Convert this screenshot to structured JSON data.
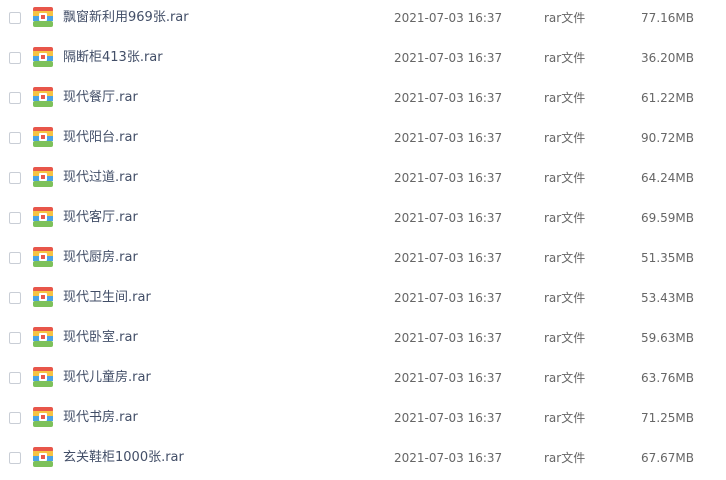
{
  "file_list": {
    "icon": "rar-archive-icon",
    "icon_colors": {
      "red": "#e8564a",
      "yellow": "#f6c344",
      "blue": "#4aa3e8",
      "green": "#7dc15a",
      "tag": "#ffffff"
    },
    "rows": [
      {
        "name": "飘窗新利用969张.rar",
        "time": "2021-07-03 16:37",
        "type": "rar文件",
        "size": "77.16MB"
      },
      {
        "name": "隔断柜413张.rar",
        "time": "2021-07-03 16:37",
        "type": "rar文件",
        "size": "36.20MB"
      },
      {
        "name": "现代餐厅.rar",
        "time": "2021-07-03 16:37",
        "type": "rar文件",
        "size": "61.22MB"
      },
      {
        "name": "现代阳台.rar",
        "time": "2021-07-03 16:37",
        "type": "rar文件",
        "size": "90.72MB"
      },
      {
        "name": "现代过道.rar",
        "time": "2021-07-03 16:37",
        "type": "rar文件",
        "size": "64.24MB"
      },
      {
        "name": "现代客厅.rar",
        "time": "2021-07-03 16:37",
        "type": "rar文件",
        "size": "69.59MB"
      },
      {
        "name": "现代厨房.rar",
        "time": "2021-07-03 16:37",
        "type": "rar文件",
        "size": "51.35MB"
      },
      {
        "name": "现代卫生间.rar",
        "time": "2021-07-03 16:37",
        "type": "rar文件",
        "size": "53.43MB"
      },
      {
        "name": "现代卧室.rar",
        "time": "2021-07-03 16:37",
        "type": "rar文件",
        "size": "59.63MB"
      },
      {
        "name": "现代儿童房.rar",
        "time": "2021-07-03 16:37",
        "type": "rar文件",
        "size": "63.76MB"
      },
      {
        "name": "现代书房.rar",
        "time": "2021-07-03 16:37",
        "type": "rar文件",
        "size": "71.25MB"
      },
      {
        "name": "玄关鞋柜1000张.rar",
        "time": "2021-07-03 16:37",
        "type": "rar文件",
        "size": "67.67MB"
      }
    ]
  }
}
